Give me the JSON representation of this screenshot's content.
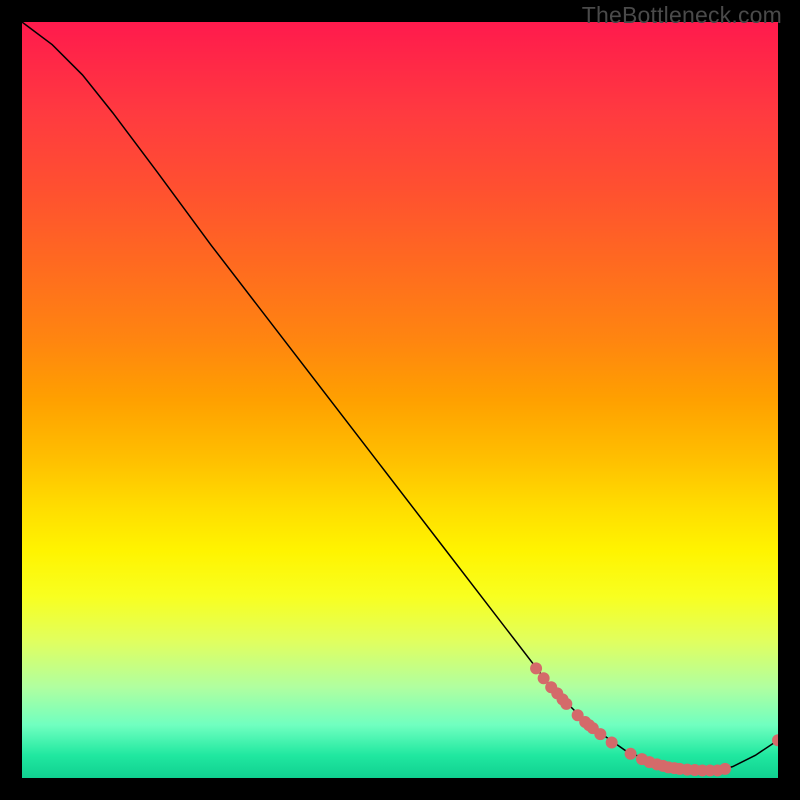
{
  "watermark": "TheBottleneck.com",
  "chart_data": {
    "type": "line",
    "title": "",
    "xlabel": "",
    "ylabel": "",
    "xlim": [
      0,
      100
    ],
    "ylim": [
      0,
      100
    ],
    "curve": [
      {
        "x": 0,
        "y": 100
      },
      {
        "x": 4,
        "y": 97
      },
      {
        "x": 8,
        "y": 93
      },
      {
        "x": 12,
        "y": 88
      },
      {
        "x": 18,
        "y": 80
      },
      {
        "x": 25,
        "y": 70.5
      },
      {
        "x": 35,
        "y": 57.5
      },
      {
        "x": 45,
        "y": 44.5
      },
      {
        "x": 55,
        "y": 31.5
      },
      {
        "x": 65,
        "y": 18.5
      },
      {
        "x": 70,
        "y": 12
      },
      {
        "x": 75,
        "y": 7
      },
      {
        "x": 80,
        "y": 3.5
      },
      {
        "x": 85,
        "y": 1.5
      },
      {
        "x": 90,
        "y": 1
      },
      {
        "x": 92,
        "y": 1
      },
      {
        "x": 94,
        "y": 1.5
      },
      {
        "x": 97,
        "y": 3
      },
      {
        "x": 100,
        "y": 5
      }
    ],
    "points": [
      {
        "x": 68,
        "y": 14.5
      },
      {
        "x": 69,
        "y": 13.2
      },
      {
        "x": 70,
        "y": 12
      },
      {
        "x": 70.8,
        "y": 11.2
      },
      {
        "x": 71.5,
        "y": 10.4
      },
      {
        "x": 72,
        "y": 9.8
      },
      {
        "x": 73.5,
        "y": 8.3
      },
      {
        "x": 74.5,
        "y": 7.4
      },
      {
        "x": 75,
        "y": 7
      },
      {
        "x": 75.5,
        "y": 6.6
      },
      {
        "x": 76.5,
        "y": 5.8
      },
      {
        "x": 78,
        "y": 4.7
      },
      {
        "x": 80.5,
        "y": 3.2
      },
      {
        "x": 82,
        "y": 2.5
      },
      {
        "x": 83,
        "y": 2.1
      },
      {
        "x": 84,
        "y": 1.8
      },
      {
        "x": 84.8,
        "y": 1.6
      },
      {
        "x": 85.5,
        "y": 1.4
      },
      {
        "x": 86.3,
        "y": 1.3
      },
      {
        "x": 87,
        "y": 1.2
      },
      {
        "x": 88,
        "y": 1.1
      },
      {
        "x": 89,
        "y": 1.05
      },
      {
        "x": 90,
        "y": 1
      },
      {
        "x": 91,
        "y": 1
      },
      {
        "x": 92,
        "y": 1
      },
      {
        "x": 93,
        "y": 1.2
      },
      {
        "x": 100,
        "y": 5
      }
    ],
    "point_color": "#d46a6a",
    "point_radius_px": 6,
    "curve_color": "#000000"
  }
}
